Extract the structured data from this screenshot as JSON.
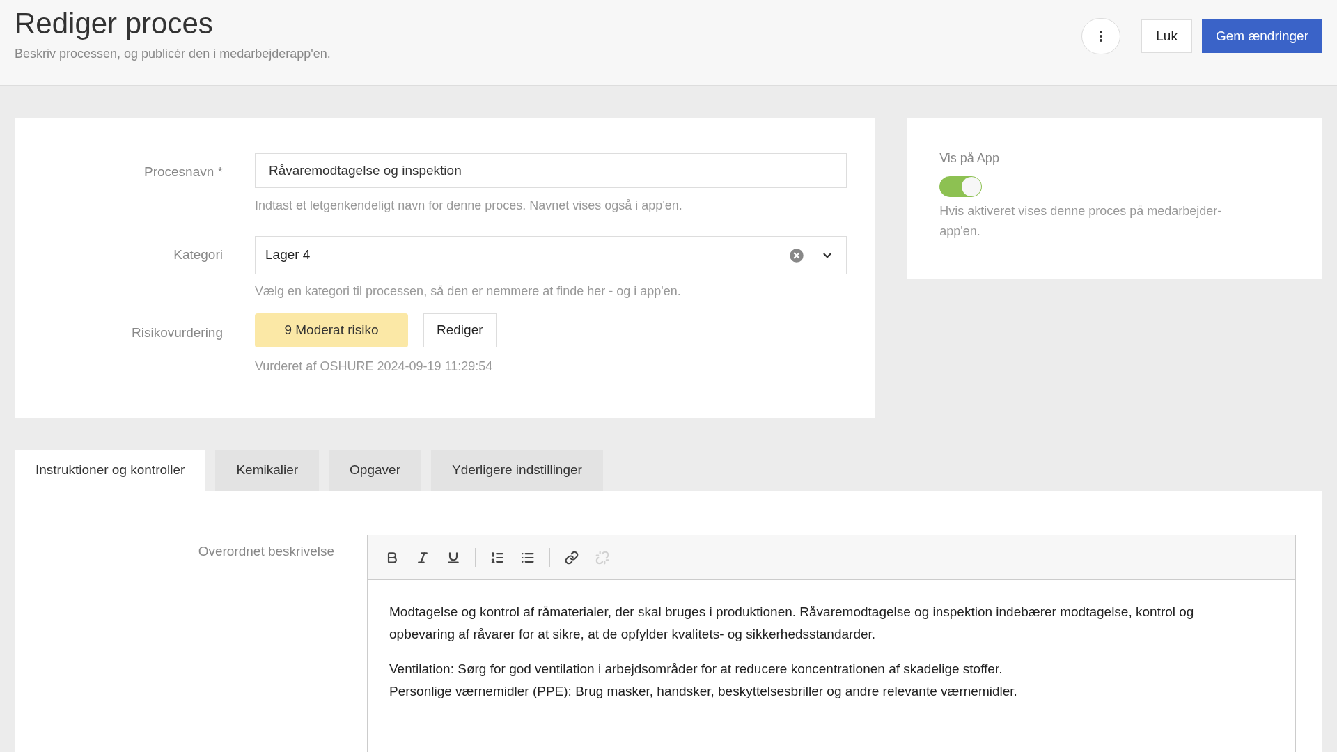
{
  "header": {
    "title": "Rediger proces",
    "subtitle": "Beskriv processen, og publicér den i medarbejderapp'en.",
    "buttons": [
      {
        "kind": "more"
      },
      {
        "kind": "secondary",
        "label": "Luk"
      },
      {
        "kind": "primary",
        "label": "Gem ændringer"
      }
    ]
  },
  "form": {
    "name": {
      "label": "Procesnavn *",
      "value": "Råvaremodtagelse og inspektion",
      "help": "Indtast et letgenkendeligt navn for denne proces. Navnet vises også i app'en."
    },
    "category": {
      "label": "Kategori",
      "value": "Lager 4",
      "help": "Vælg en kategori til processen, så den er nemmere at finde her - og i app'en."
    },
    "risk": {
      "label": "Risikovurdering",
      "badge": "9 Moderat risiko",
      "color": "#fbe8a6",
      "button": "Rediger",
      "note": "Vurderet af OSHURE 2024-09-19 11:29:54"
    }
  },
  "app_panel": {
    "label": "Vis på App",
    "on": true,
    "help": "Hvis aktiveret vises denne proces på medarbejder-app'en."
  },
  "tabs": [
    {
      "label": "Instruktioner og kontroller",
      "selected": true
    },
    {
      "label": "Kemikalier",
      "selected": false
    },
    {
      "label": "Opgaver",
      "selected": false
    },
    {
      "label": "Yderligere indstillinger",
      "selected": false
    }
  ],
  "editor": {
    "label": "Overordnet beskrivelse",
    "toolbar": [
      {
        "kind": "bold",
        "disabled": false
      },
      {
        "kind": "italic",
        "disabled": false
      },
      {
        "kind": "underline",
        "disabled": false
      },
      {
        "kind": "separator"
      },
      {
        "kind": "ordered-list",
        "disabled": false
      },
      {
        "kind": "bullet-list",
        "disabled": false
      },
      {
        "kind": "separator"
      },
      {
        "kind": "link",
        "disabled": false
      },
      {
        "kind": "unlink",
        "disabled": true
      }
    ],
    "paragraphs": [
      {
        "lines": [
          "Modtagelse og kontrol af råmaterialer, der skal bruges i produktionen. Råvaremodtagelse og inspektion indebærer modtagelse, kontrol og opbevaring af råvarer for at sikre, at de opfylder kvalitets- og sikkerhedsstandarder."
        ]
      },
      {
        "lines": [
          "Ventilation: Sørg for god ventilation i arbejdsområder for at reducere koncentrationen af skadelige stoffer.",
          "Personlige værnemidler (PPE): Brug masker, handsker, beskyttelsesbriller og andre relevante værnemidler."
        ]
      }
    ]
  }
}
